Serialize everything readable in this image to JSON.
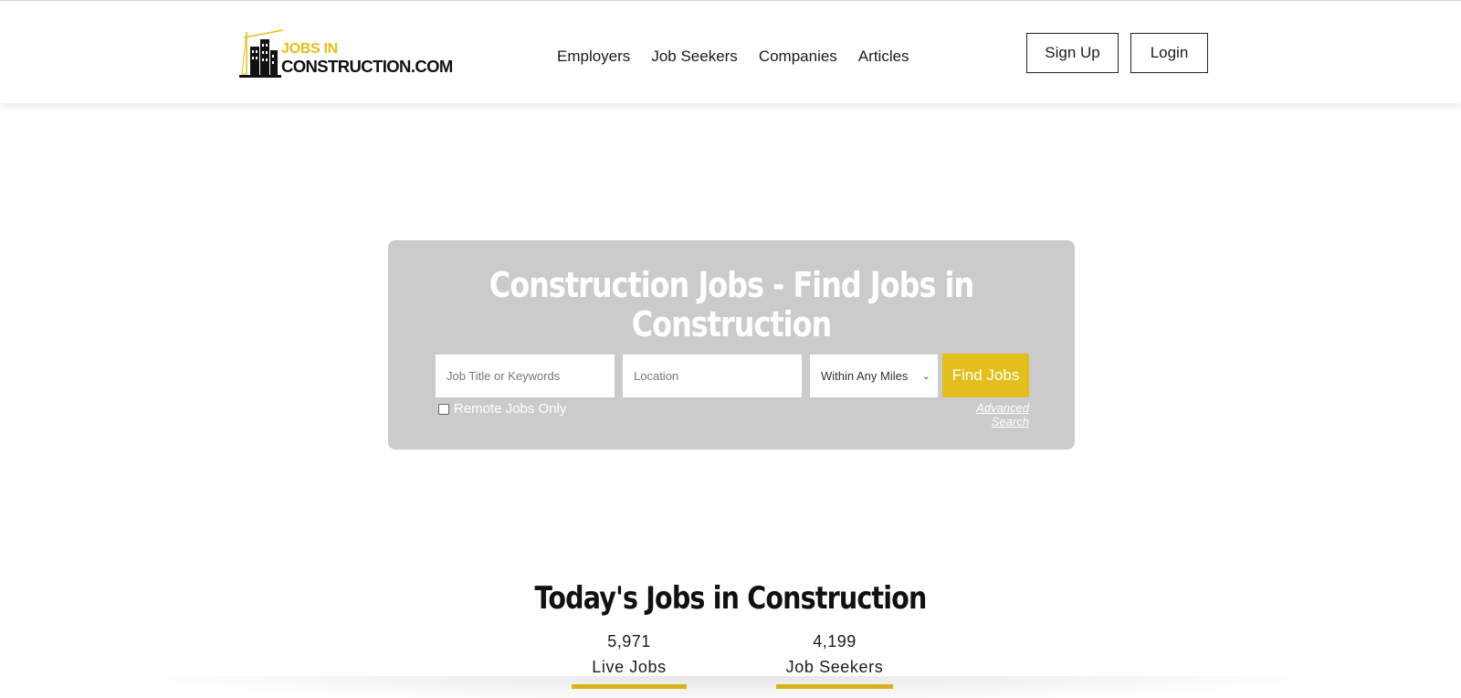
{
  "brand": {
    "line1": "JOBS IN",
    "line2": "CONSTRUCTION.COM",
    "accent": "#e2bf1d"
  },
  "nav": {
    "items": [
      "Employers",
      "Job Seekers",
      "Companies",
      "Articles"
    ]
  },
  "auth": {
    "signup": "Sign Up",
    "login": "Login"
  },
  "search": {
    "title": "Construction Jobs - Find Jobs in Construction",
    "keyword_placeholder": "Job Title or Keywords",
    "location_placeholder": "Location",
    "miles_selected": "Within Any Miles",
    "find_button": "Find Jobs",
    "remote_label": "Remote Jobs Only",
    "remote_checked": false,
    "advanced": "Advanced Search",
    "panel_color": "#cbcbcb"
  },
  "stats": {
    "title": "Today's Jobs in Construction",
    "live_jobs_count": "5,971",
    "live_jobs_label": "Live Jobs",
    "job_seekers_count": "4,199",
    "job_seekers_label": "Job Seekers"
  }
}
